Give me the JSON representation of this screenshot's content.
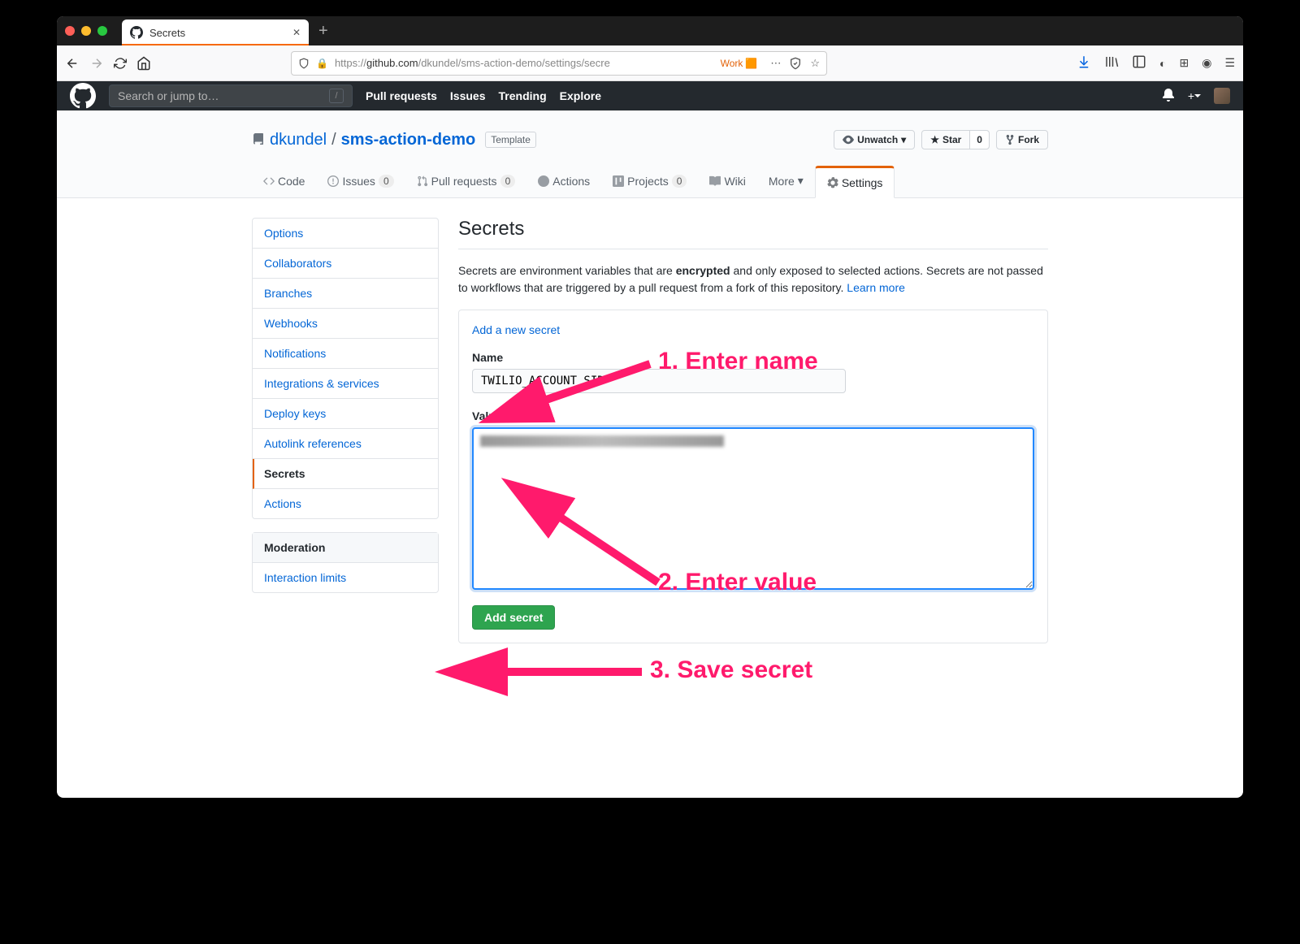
{
  "browser": {
    "tab_title": "Secrets",
    "url_display_prefix": "https://",
    "url_display_bold": "github.com",
    "url_display_suffix": "/dkundel/sms-action-demo/settings/secre",
    "container_label": "Work"
  },
  "github": {
    "search_placeholder": "Search or jump to…",
    "nav": {
      "pulls": "Pull requests",
      "issues": "Issues",
      "trending": "Trending",
      "explore": "Explore"
    }
  },
  "repo": {
    "owner": "dkundel",
    "name": "sms-action-demo",
    "template_label": "Template",
    "watch": "Unwatch",
    "star": "Star",
    "star_count": "0",
    "fork": "Fork"
  },
  "repo_tabs": {
    "code": "Code",
    "issues": "Issues",
    "issues_count": "0",
    "prs": "Pull requests",
    "prs_count": "0",
    "actions": "Actions",
    "projects": "Projects",
    "projects_count": "0",
    "wiki": "Wiki",
    "more": "More",
    "settings": "Settings"
  },
  "sidebar": {
    "items": [
      "Options",
      "Collaborators",
      "Branches",
      "Webhooks",
      "Notifications",
      "Integrations & services",
      "Deploy keys",
      "Autolink references",
      "Secrets",
      "Actions"
    ],
    "moderation_heading": "Moderation",
    "moderation_items": [
      "Interaction limits"
    ]
  },
  "page": {
    "title": "Secrets",
    "desc_1": "Secrets are environment variables that are ",
    "desc_bold": "encrypted",
    "desc_2": " and only exposed to selected actions. Secrets are not passed to workflows that are triggered by a pull request from a fork of this repository. ",
    "learn_more": "Learn more",
    "add_new": "Add a new secret",
    "name_label": "Name",
    "name_value": "TWILIO_ACCOUNT_SID",
    "value_label": "Value",
    "submit": "Add secret"
  },
  "annotations": {
    "a1": "1. Enter name",
    "a2": "2. Enter value",
    "a3": "3. Save secret"
  }
}
